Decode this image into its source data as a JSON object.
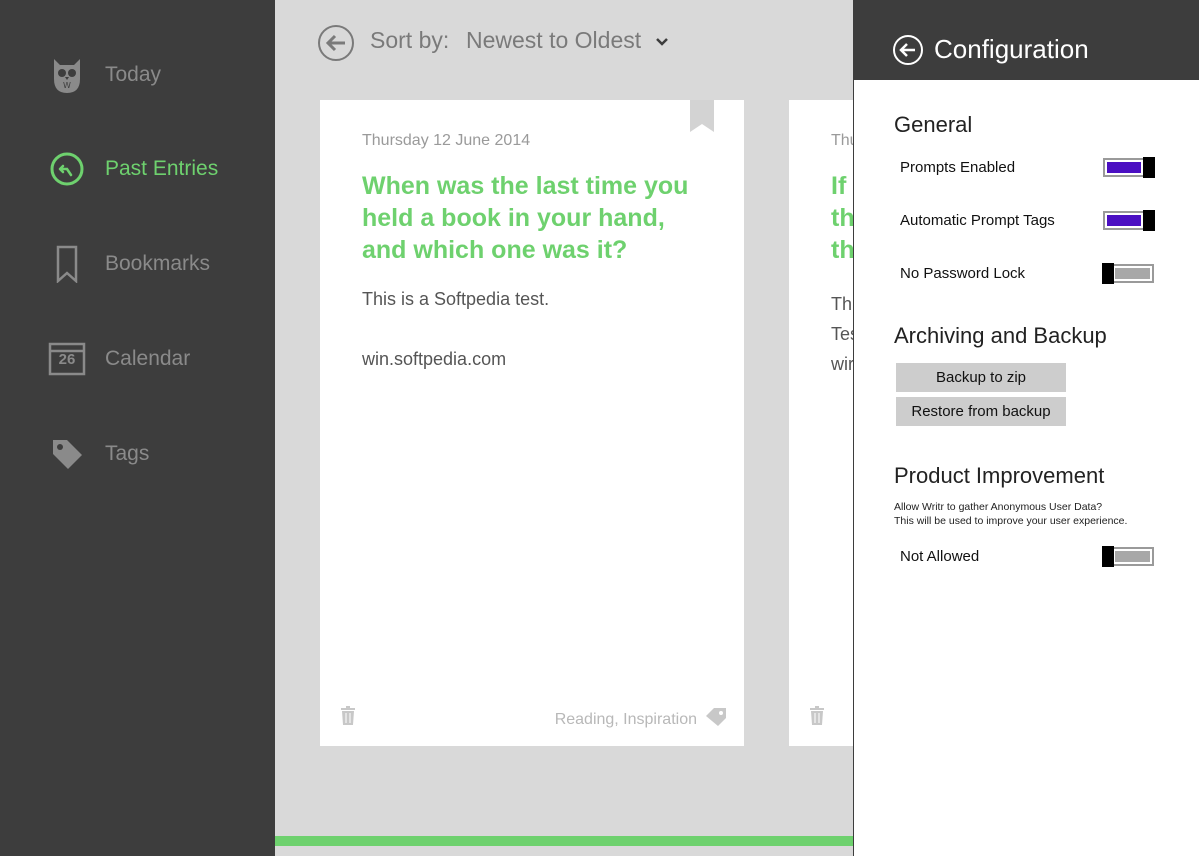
{
  "sidebar": {
    "items": [
      {
        "label": "Today",
        "icon": "owl-icon"
      },
      {
        "label": "Past Entries",
        "icon": "clock-back-icon",
        "active": true
      },
      {
        "label": "Bookmarks",
        "icon": "bookmark-icon"
      },
      {
        "label": "Calendar",
        "icon": "calendar-icon",
        "calendar_day": "26"
      },
      {
        "label": "Tags",
        "icon": "tag-icon"
      }
    ]
  },
  "main": {
    "sort_label": "Sort by:",
    "sort_value": "Newest to Oldest",
    "cards": [
      {
        "date": "Thursday 12 June 2014",
        "prompt": "When was the last time you held a book in your hand, and which one was it?",
        "body_lines": [
          "This is a Softpedia test.",
          "win.softpedia.com"
        ],
        "tags": "Reading, Inspiration"
      },
      {
        "date": "Thu",
        "prompt_lines": [
          "If",
          "th",
          "th"
        ],
        "body_lines": [
          "Thi",
          "Tes",
          "wir"
        ]
      }
    ]
  },
  "config": {
    "title": "Configuration",
    "general": {
      "title": "General",
      "settings": [
        {
          "label": "Prompts Enabled",
          "on": true
        },
        {
          "label": "Automatic Prompt Tags",
          "on": true
        },
        {
          "label": "No Password Lock",
          "on": false
        }
      ]
    },
    "archiving": {
      "title": "Archiving and Backup",
      "backup_label": "Backup to zip",
      "restore_label": "Restore from backup"
    },
    "improvement": {
      "title": "Product Improvement",
      "description_line1": "Allow Writr to gather Anonymous User Data?",
      "description_line2": "This will be used to improve your user experience.",
      "setting_label": "Not Allowed",
      "on": false
    }
  },
  "colors": {
    "accent_green": "#6ed16e",
    "toggle_on": "#4b0fc2",
    "sidebar_bg": "#3d3d3d"
  }
}
